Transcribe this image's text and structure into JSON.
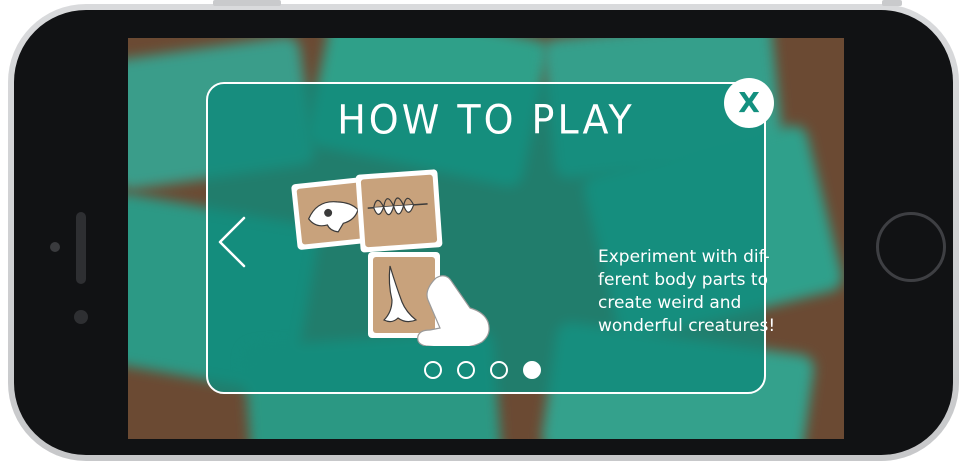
{
  "modal": {
    "title": "HOW TO PLAY",
    "instruction": "Experiment with dif-\nferent body parts to\ncreate weird and\nwonderful creatures!",
    "close_label": "X",
    "prev_icon": "chevron-left-icon",
    "illustration_icon": "skeleton-cards-hand-illustration"
  },
  "pagination": {
    "total": 4,
    "current": 4
  },
  "colors": {
    "modal_teal": "#0f8a7a",
    "close_x": "#13907f",
    "card_tan": "#c8a27c",
    "background_wood": "#6b4a33",
    "background_card": "#2b9c86",
    "phone_frame": "#111214",
    "phone_bezel": "#d9dadc"
  }
}
